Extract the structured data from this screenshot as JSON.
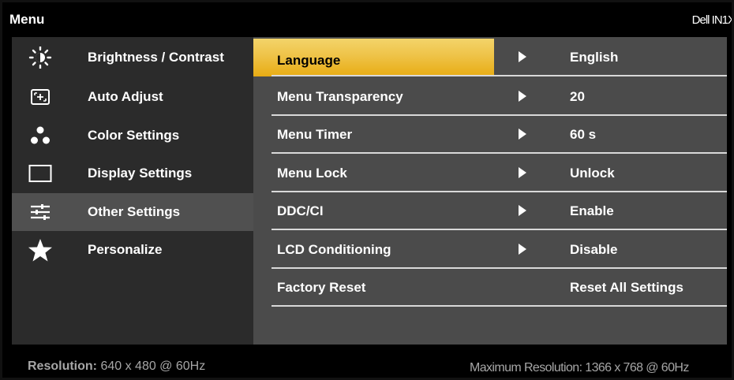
{
  "header": {
    "title": "Menu",
    "model": "Dell IN1X"
  },
  "sidebar": {
    "items": [
      {
        "label": "Brightness / Contrast",
        "icon": "brightness-icon"
      },
      {
        "label": "Auto Adjust",
        "icon": "auto-adjust-icon"
      },
      {
        "label": "Color Settings",
        "icon": "color-settings-icon"
      },
      {
        "label": "Display Settings",
        "icon": "display-settings-icon"
      },
      {
        "label": "Other Settings",
        "icon": "other-settings-icon",
        "active": true
      },
      {
        "label": "Personalize",
        "icon": "star-icon"
      }
    ]
  },
  "settings": {
    "rows": [
      {
        "name": "Language",
        "value": "English",
        "selected": true
      },
      {
        "name": "Menu Transparency",
        "value": "20"
      },
      {
        "name": "Menu Timer",
        "value": "60 s"
      },
      {
        "name": "Menu Lock",
        "value": "Unlock"
      },
      {
        "name": "DDC/CI",
        "value": "Enable"
      },
      {
        "name": "LCD Conditioning",
        "value": "Disable"
      },
      {
        "name": "Factory Reset",
        "value": "Reset All Settings"
      }
    ]
  },
  "footer": {
    "resolution_label": "Resolution:",
    "resolution_value": "640 x 480 @ 60Hz",
    "max_resolution": "Maximum Resolution: 1366 x 768 @ 60Hz"
  },
  "colors": {
    "highlight": "#efc54c",
    "sidebar_bg": "#2b2b2b",
    "panel_bg": "#4b4b4b",
    "active_bg": "#505050"
  }
}
